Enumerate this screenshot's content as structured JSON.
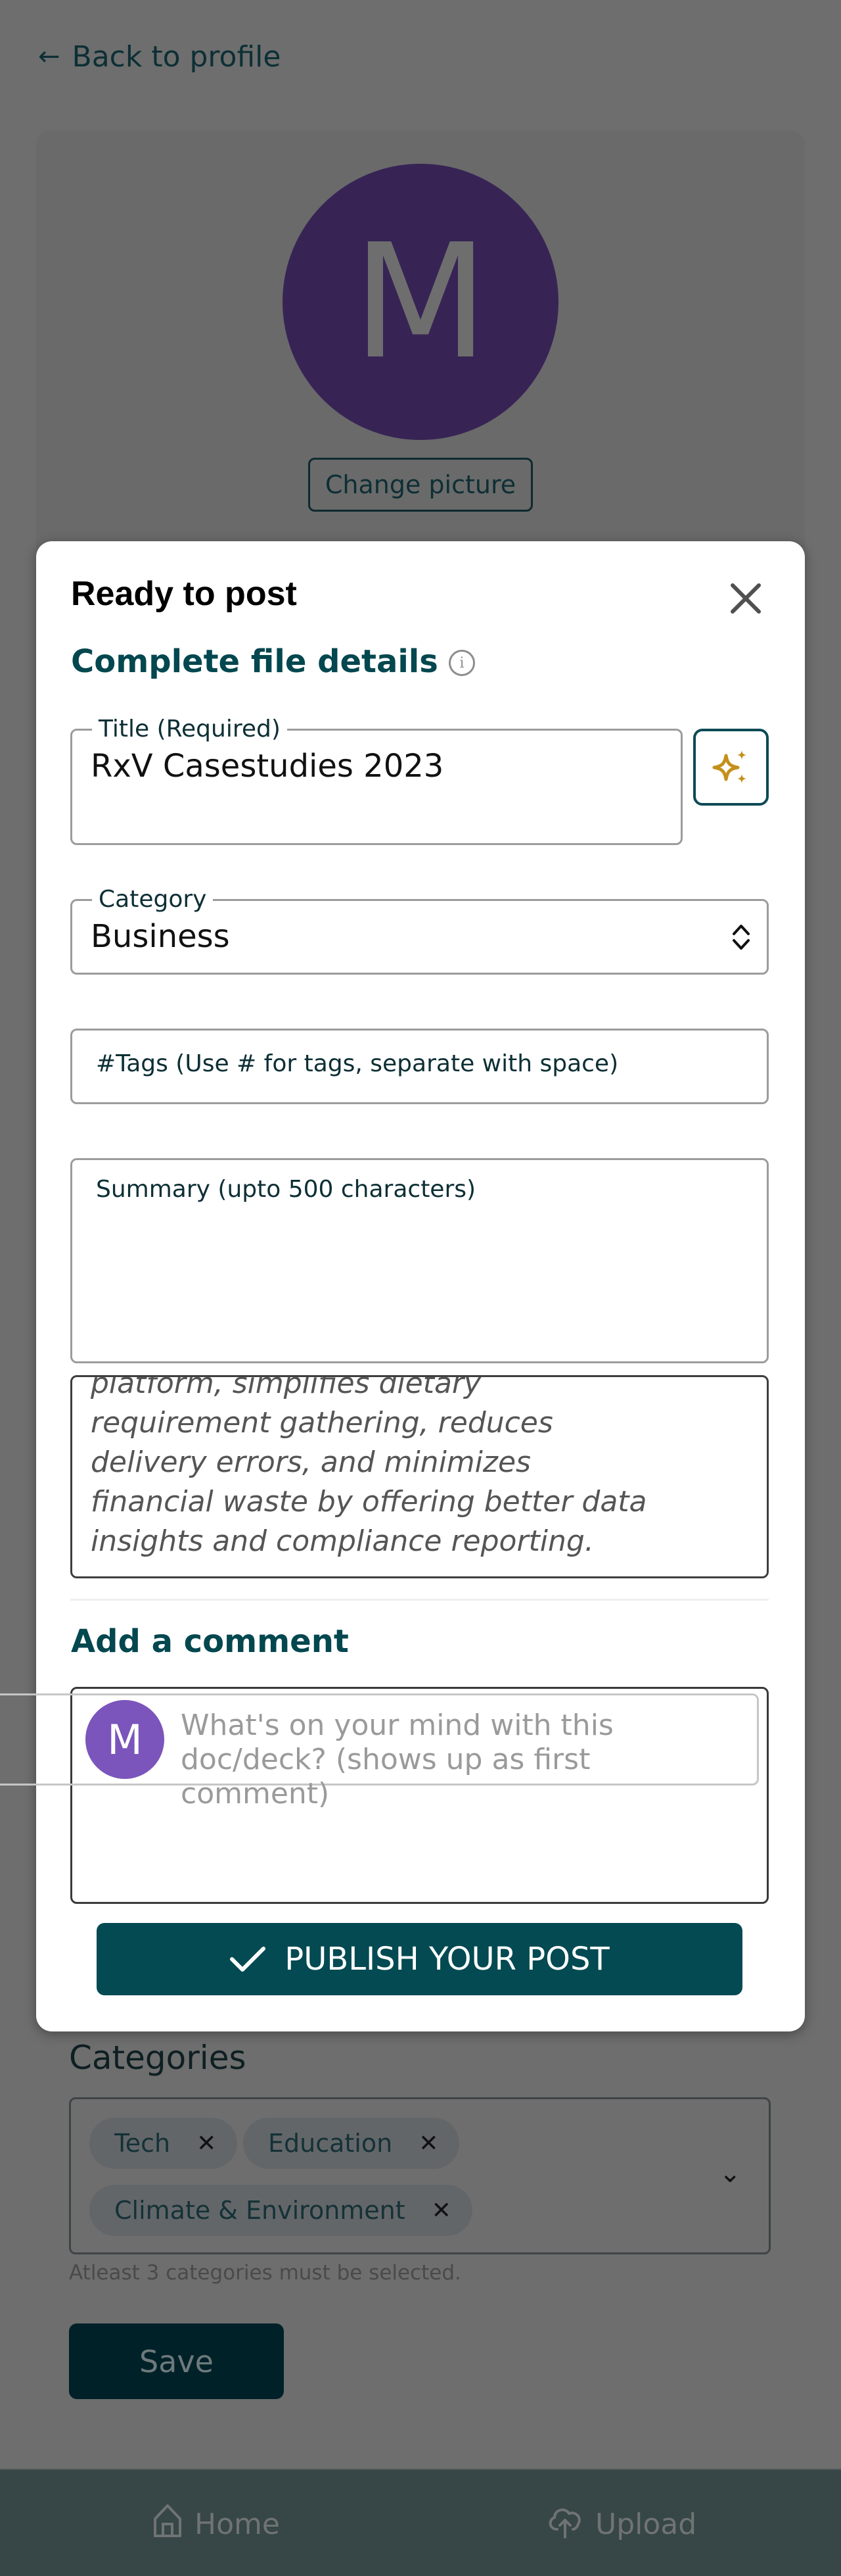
{
  "page": {
    "back_link": "Back to profile",
    "avatar_initial": "M",
    "change_picture": "Change picture",
    "categories_label": "Categories",
    "categories": [
      {
        "label": "Tech"
      },
      {
        "label": "Education"
      },
      {
        "label": "Climate & Environment"
      }
    ],
    "categories_helper": "Atleast 3 categories must be selected.",
    "save_label": "Save"
  },
  "bottom_nav": {
    "items": [
      {
        "label": "Home",
        "icon": "home-icon"
      },
      {
        "label": "Upload",
        "icon": "cloud-upload-icon"
      }
    ]
  },
  "modal": {
    "title": "Ready to post",
    "close_icon": "close-icon",
    "section_title": "Complete file details",
    "title_field": {
      "label": "Title (Required)",
      "value": "RxV Casestudies 2023"
    },
    "ai_button_icon": "sparkles-icon",
    "category_field": {
      "label": "Category",
      "value": "Business"
    },
    "tags_field": {
      "placeholder": "#Tags (Use # for tags, separate with space)"
    },
    "summary_field": {
      "placeholder": "Summary (upto 500 characters)"
    },
    "description_text": "platform, simplifies dietary requirement gathering, reduces delivery errors, and minimizes financial waste by offering better data insights and compliance reporting.",
    "comment_section_title": "Add a comment",
    "comment_avatar_initial": "M",
    "comment_placeholder": "What's on your mind with this doc/deck? (shows up as first comment)",
    "publish_label": "PUBLISH YOUR POST"
  },
  "colors": {
    "brand_teal": "#034a52",
    "ai_gold": "#c4901b",
    "avatar_purple": "#7b55bb",
    "avatar_dark_purple": "#372455",
    "overlay": "#6e6e6e"
  }
}
